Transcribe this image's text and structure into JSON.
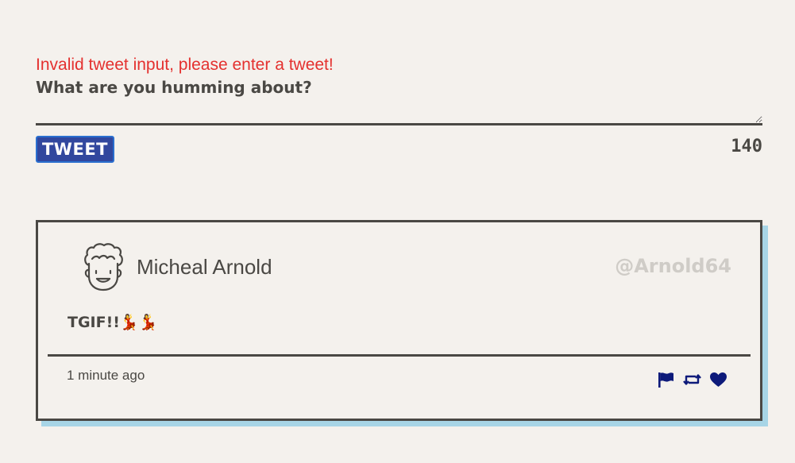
{
  "compose": {
    "error_message": "Invalid tweet input, please enter a tweet!",
    "prompt_label": "What are you humming about?",
    "textarea_value": "",
    "tweet_button_label": "TWEET",
    "char_counter": "140"
  },
  "tweet": {
    "user_name": "Micheal Arnold",
    "user_handle": "@Arnold64",
    "text": "TGIF!!💃💃",
    "timestamp": "1 minute ago",
    "actions": {
      "flag_icon": "flag-icon",
      "retweet_icon": "retweet-icon",
      "like_icon": "heart-icon"
    }
  },
  "colors": {
    "background": "#f4f1ed",
    "error": "#e4312f",
    "button": "#31479e",
    "shadow": "#a7d5e6",
    "icon": "#0d1a7a",
    "handle": "#cfccc7"
  }
}
